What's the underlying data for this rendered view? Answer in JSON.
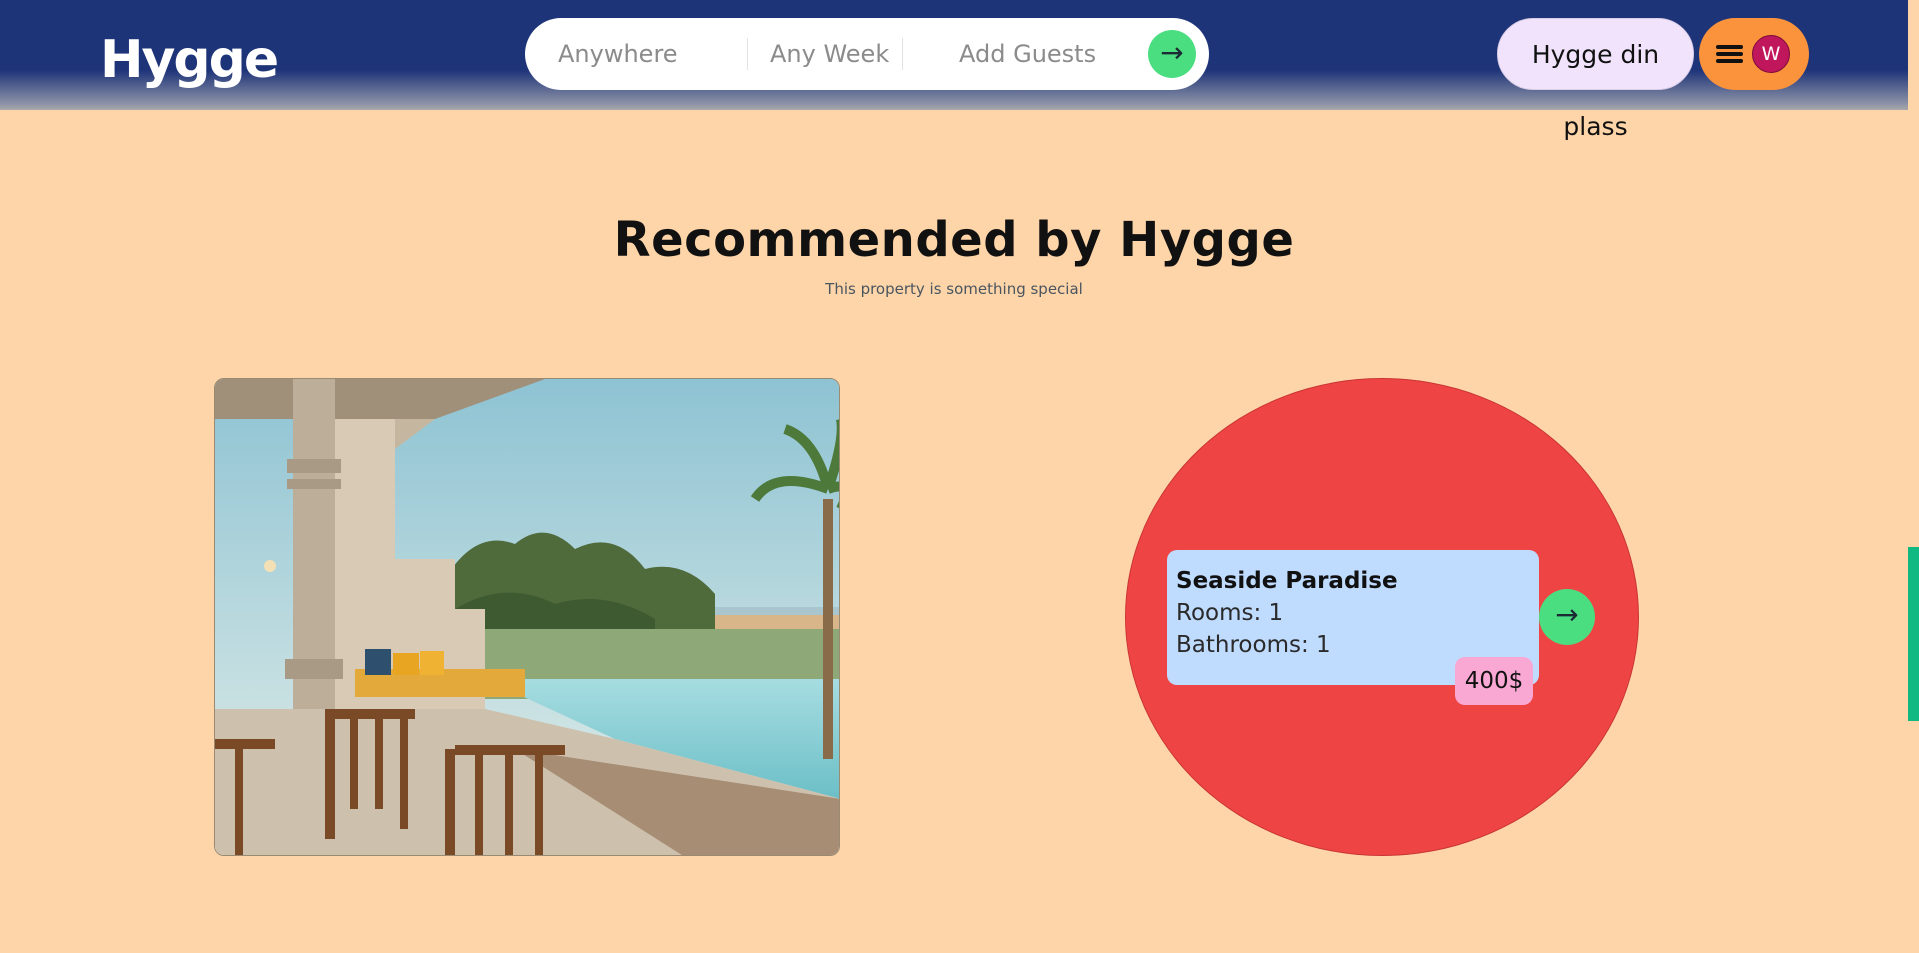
{
  "header": {
    "logo": "Hygge",
    "search": {
      "location": "Anywhere",
      "dates": "Any Week",
      "guests": "Add Guests",
      "submit_icon": "arrow-right-icon"
    },
    "host_label": "Hygge din plass",
    "menu_icon": "hamburger-icon",
    "avatar_initial": "W"
  },
  "main": {
    "title": "Recommended by Hygge",
    "subtitle": "This property is something special"
  },
  "listing": {
    "name": "Seaside Paradise",
    "rooms": "Rooms: 1",
    "bathrooms": "Bathrooms: 1",
    "price": "400$",
    "open_icon": "arrow-right-icon"
  },
  "colors": {
    "header_bg": "#1e3479",
    "page_bg": "#fdd5a8",
    "search_button": "#4ade80",
    "host_button": "#f0e3fb",
    "menu_button": "#fb923c",
    "avatar": "#c0165c",
    "circle": "#ef4444",
    "card": "#bfdbfe",
    "price_badge": "#f9a8d4",
    "scrollbar_thumb": "#10b981"
  }
}
